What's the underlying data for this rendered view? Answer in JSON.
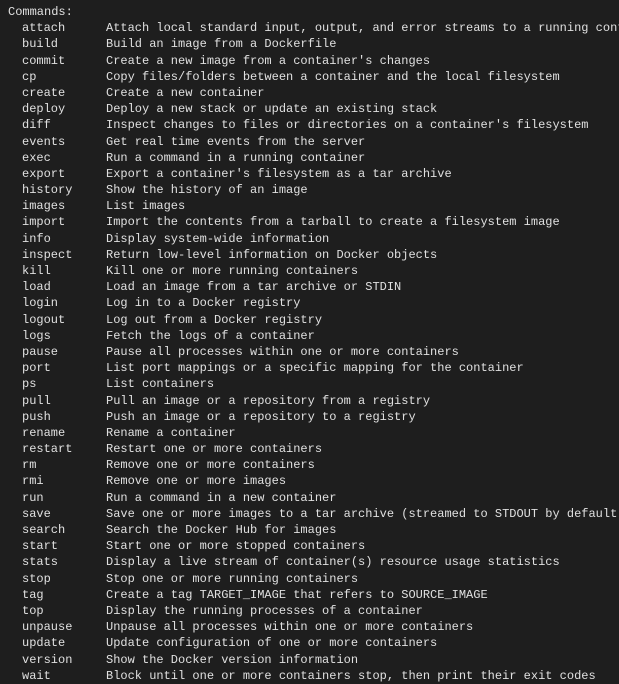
{
  "header": "Commands:",
  "commands": [
    {
      "name": "attach",
      "desc": "Attach local standard input, output, and error streams to a running container"
    },
    {
      "name": "build",
      "desc": "Build an image from a Dockerfile"
    },
    {
      "name": "commit",
      "desc": "Create a new image from a container's changes"
    },
    {
      "name": "cp",
      "desc": "Copy files/folders between a container and the local filesystem"
    },
    {
      "name": "create",
      "desc": "Create a new container"
    },
    {
      "name": "deploy",
      "desc": "Deploy a new stack or update an existing stack"
    },
    {
      "name": "diff",
      "desc": "Inspect changes to files or directories on a container's filesystem"
    },
    {
      "name": "events",
      "desc": "Get real time events from the server"
    },
    {
      "name": "exec",
      "desc": "Run a command in a running container"
    },
    {
      "name": "export",
      "desc": "Export a container's filesystem as a tar archive"
    },
    {
      "name": "history",
      "desc": "Show the history of an image"
    },
    {
      "name": "images",
      "desc": "List images"
    },
    {
      "name": "import",
      "desc": "Import the contents from a tarball to create a filesystem image"
    },
    {
      "name": "info",
      "desc": "Display system-wide information"
    },
    {
      "name": "inspect",
      "desc": "Return low-level information on Docker objects"
    },
    {
      "name": "kill",
      "desc": "Kill one or more running containers"
    },
    {
      "name": "load",
      "desc": "Load an image from a tar archive or STDIN"
    },
    {
      "name": "login",
      "desc": "Log in to a Docker registry"
    },
    {
      "name": "logout",
      "desc": "Log out from a Docker registry"
    },
    {
      "name": "logs",
      "desc": "Fetch the logs of a container"
    },
    {
      "name": "pause",
      "desc": "Pause all processes within one or more containers"
    },
    {
      "name": "port",
      "desc": "List port mappings or a specific mapping for the container"
    },
    {
      "name": "ps",
      "desc": "List containers"
    },
    {
      "name": "pull",
      "desc": "Pull an image or a repository from a registry"
    },
    {
      "name": "push",
      "desc": "Push an image or a repository to a registry"
    },
    {
      "name": "rename",
      "desc": "Rename a container"
    },
    {
      "name": "restart",
      "desc": "Restart one or more containers"
    },
    {
      "name": "rm",
      "desc": "Remove one or more containers"
    },
    {
      "name": "rmi",
      "desc": "Remove one or more images"
    },
    {
      "name": "run",
      "desc": "Run a command in a new container"
    },
    {
      "name": "save",
      "desc": "Save one or more images to a tar archive (streamed to STDOUT by default)"
    },
    {
      "name": "search",
      "desc": "Search the Docker Hub for images"
    },
    {
      "name": "start",
      "desc": "Start one or more stopped containers"
    },
    {
      "name": "stats",
      "desc": "Display a live stream of container(s) resource usage statistics"
    },
    {
      "name": "stop",
      "desc": "Stop one or more running containers"
    },
    {
      "name": "tag",
      "desc": "Create a tag TARGET_IMAGE that refers to SOURCE_IMAGE"
    },
    {
      "name": "top",
      "desc": "Display the running processes of a container"
    },
    {
      "name": "unpause",
      "desc": "Unpause all processes within one or more containers"
    },
    {
      "name": "update",
      "desc": "Update configuration of one or more containers"
    },
    {
      "name": "version",
      "desc": "Show the Docker version information"
    },
    {
      "name": "wait",
      "desc": "Block until one or more containers stop, then print their exit codes"
    }
  ]
}
